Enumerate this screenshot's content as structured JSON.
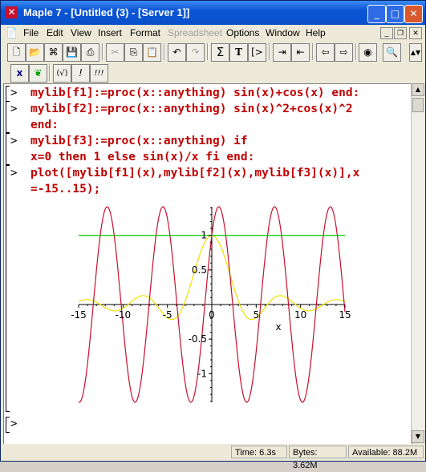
{
  "window": {
    "title": "Maple 7  - [Untitled (3) - [Server 1]]",
    "app_icon": "maple-x-icon"
  },
  "menu": {
    "items": [
      "File",
      "Edit",
      "View",
      "Insert",
      "Format",
      "Spreadsheet",
      "Options",
      "Window",
      "Help"
    ],
    "disabled": [
      "Spreadsheet"
    ]
  },
  "toolbar1": {
    "buttons": [
      "new",
      "open",
      "open-url",
      "save",
      "print",
      "cut",
      "copy",
      "paste",
      "undo",
      "redo",
      "sum",
      "T",
      "exec",
      "indent",
      "outdent",
      "back",
      "forward",
      "stop",
      "zoom"
    ]
  },
  "toolbar2": {
    "buttons": [
      "x",
      "maple-leaf",
      "(√)",
      "!",
      "!!!"
    ]
  },
  "worksheet": {
    "lines": [
      {
        "prompt": ">",
        "code": "mylib[f1]:=proc(x::anything) sin(x)+cos(x) end:"
      },
      {
        "prompt": ">",
        "code": "mylib[f2]:=proc(x::anything) sin(x)^2+cos(x)^2"
      },
      {
        "prompt": "",
        "code": "end:"
      },
      {
        "prompt": ">",
        "code": "mylib[f3]:=proc(x::anything) if"
      },
      {
        "prompt": "",
        "code": "x=0 then 1 else sin(x)/x fi end:"
      },
      {
        "prompt": ">",
        "code": "plot([mylib[f1](x),mylib[f2](x),mylib[f3](x)],x"
      },
      {
        "prompt": "",
        "code": "=-15..15);"
      },
      {
        "prompt": ">",
        "code": ""
      }
    ]
  },
  "chart_data": {
    "type": "line",
    "xlim": [
      -15,
      15
    ],
    "ylim": [
      -1.414,
      1.414
    ],
    "xticks": [
      -15,
      -10,
      -5,
      0,
      5,
      10,
      15
    ],
    "xtick_labels": [
      "-15",
      "-10",
      "-5",
      "0",
      "5",
      "10",
      "15"
    ],
    "yticks": [
      1,
      0.5,
      -0.5,
      -1
    ],
    "ytick_labels": [
      "1",
      "0.5",
      "-0.5",
      "-1"
    ],
    "xlabel": "x",
    "series": [
      {
        "function": "sin(x)+cos(x)",
        "color": "#c8102e"
      },
      {
        "function": "sin(x)^2+cos(x)^2",
        "color": "#00c800"
      },
      {
        "function": "sin(x)/x",
        "color": "#f0e000"
      }
    ]
  },
  "status": {
    "time": "Time:   6.3s",
    "bytes": "Bytes: 3.62M",
    "available": "Available: 88.2M"
  }
}
